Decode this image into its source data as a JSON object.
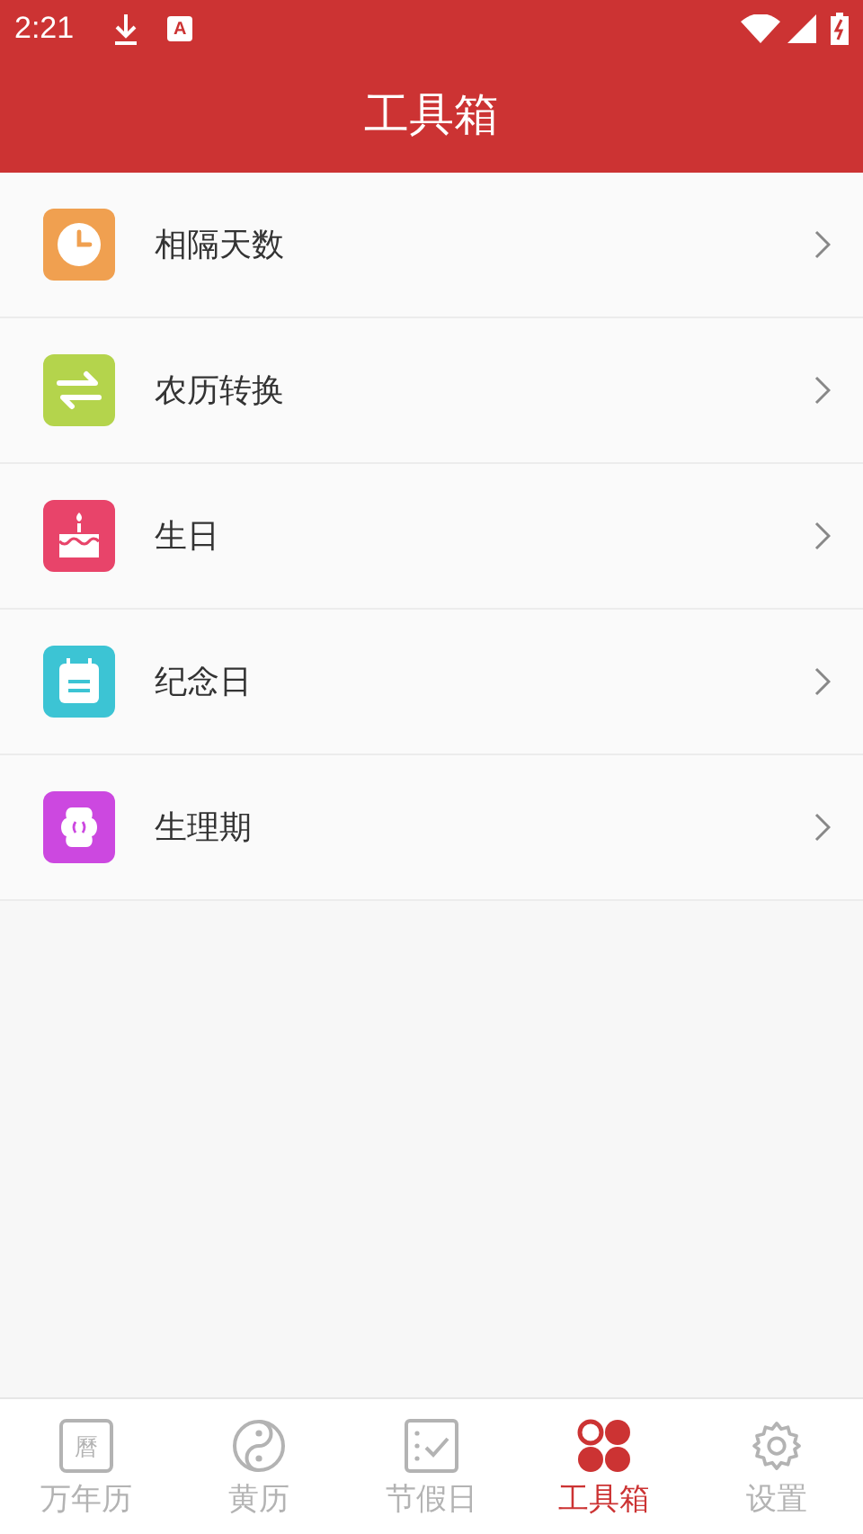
{
  "status_bar": {
    "time": "2:21",
    "notification_glyph": "A"
  },
  "header": {
    "title": "工具箱"
  },
  "items": [
    {
      "label": "相隔天数",
      "kind": "clock",
      "color": "#f0a050"
    },
    {
      "label": "农历转换",
      "kind": "swap",
      "color": "#b4d44c"
    },
    {
      "label": "生日",
      "kind": "cake",
      "color": "#e8446a"
    },
    {
      "label": "纪念日",
      "kind": "calendar",
      "color": "#3cc4d4"
    },
    {
      "label": "生理期",
      "kind": "flower",
      "color": "#cc48e0"
    }
  ],
  "tabs": [
    {
      "label": "万年历",
      "kind": "calendar",
      "glyph": "曆",
      "selected": false
    },
    {
      "label": "黄历",
      "kind": "yinyang",
      "selected": false
    },
    {
      "label": "节假日",
      "kind": "checklist",
      "selected": false
    },
    {
      "label": "工具箱",
      "kind": "grid",
      "selected": true
    },
    {
      "label": "设置",
      "kind": "gear",
      "selected": false
    }
  ]
}
